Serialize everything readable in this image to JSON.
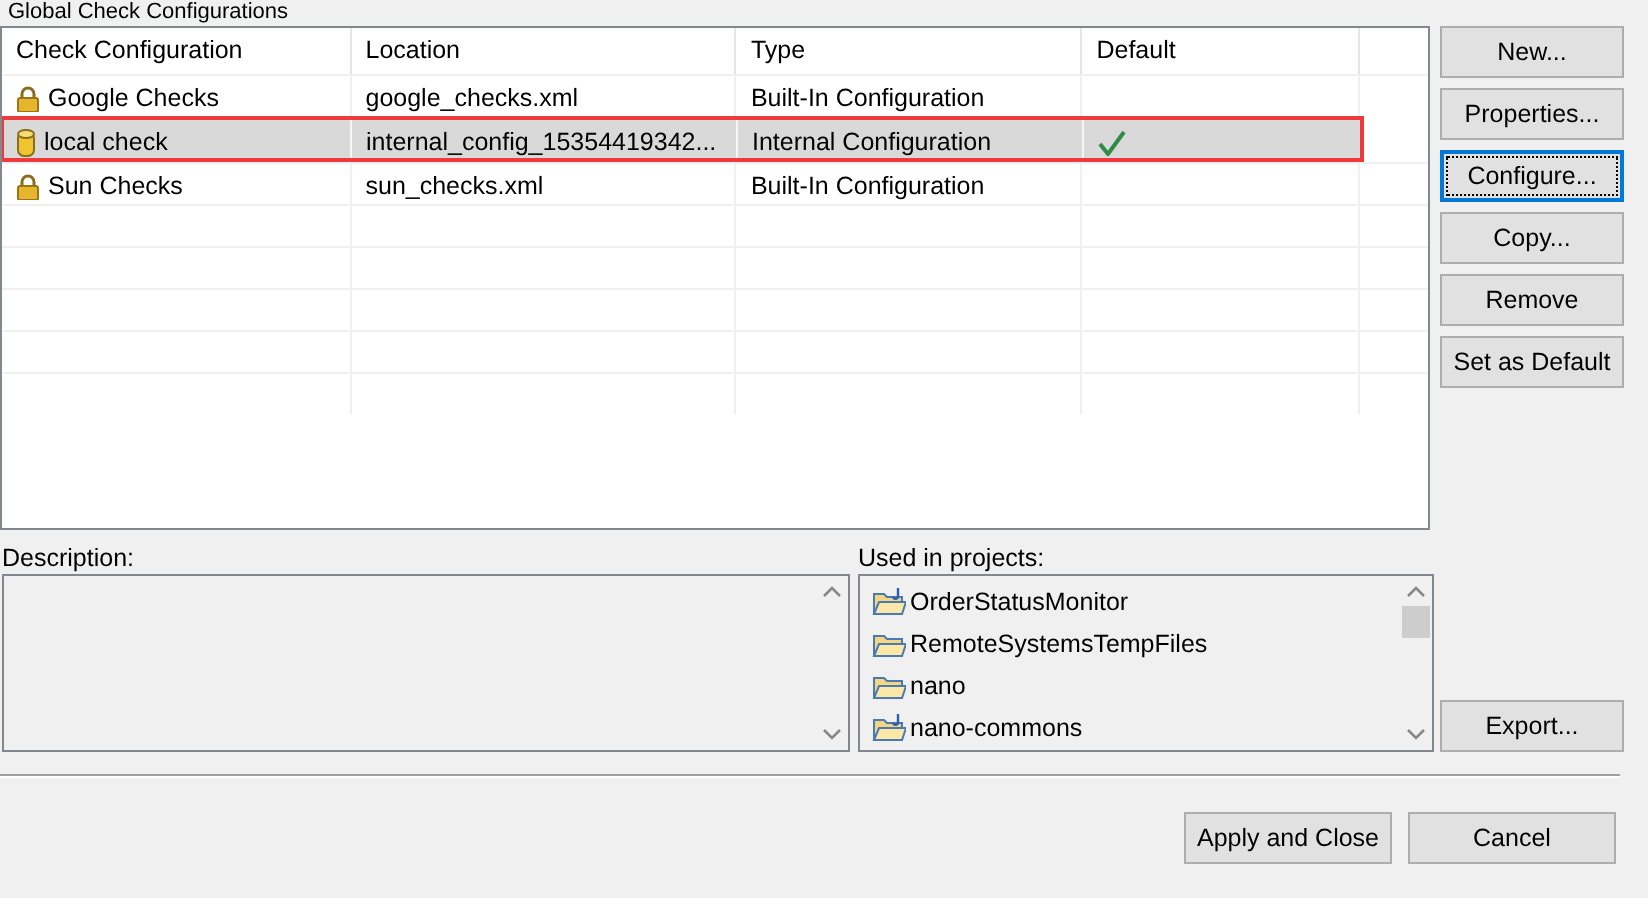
{
  "group_title": "Global Check Configurations",
  "table": {
    "columns": [
      "Check Configuration",
      "Location",
      "Type",
      "Default"
    ],
    "rows": [
      {
        "kind": "builtin",
        "name": "Google Checks",
        "location": "google_checks.xml",
        "type": "Built-In Configuration",
        "default": false,
        "selected": false
      },
      {
        "kind": "internal",
        "name": "local check",
        "location": "internal_config_15354419342...",
        "type": "Internal Configuration",
        "default": true,
        "selected": true
      },
      {
        "kind": "builtin",
        "name": "Sun Checks",
        "location": "sun_checks.xml",
        "type": "Built-In Configuration",
        "default": false,
        "selected": false
      }
    ]
  },
  "side_buttons": [
    {
      "label": "New...",
      "focused": false
    },
    {
      "label": "Properties...",
      "focused": false
    },
    {
      "label": "Configure...",
      "focused": true
    },
    {
      "label": "Copy...",
      "focused": false
    },
    {
      "label": "Remove",
      "focused": false
    },
    {
      "label": "Set as Default",
      "focused": false
    }
  ],
  "description": {
    "label": "Description:"
  },
  "projects": {
    "label": "Used in projects:",
    "items": [
      {
        "kind": "java-project",
        "name": "OrderStatusMonitor"
      },
      {
        "kind": "folder",
        "name": "RemoteSystemsTempFiles"
      },
      {
        "kind": "folder",
        "name": "nano"
      },
      {
        "kind": "java-project",
        "name": "nano-commons"
      }
    ]
  },
  "export_button": "Export...",
  "footer_buttons": [
    "Apply and Close",
    "Cancel"
  ]
}
